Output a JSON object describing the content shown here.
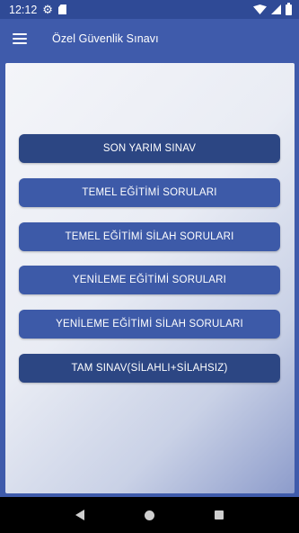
{
  "status_bar": {
    "time": "12:12",
    "icons": [
      "gear-icon",
      "sd-card-icon",
      "wifi-icon",
      "signal-icon",
      "battery-icon"
    ]
  },
  "app_bar": {
    "title": "Özel Güvenlik Sınavı",
    "menu_icon": "menu-icon"
  },
  "menu": {
    "items": [
      {
        "label": "SON YARIM SINAV",
        "style": "dark"
      },
      {
        "label": "TEMEL EĞİTİMİ SORULARI",
        "style": "mid"
      },
      {
        "label": "TEMEL EĞİTİMİ SİLAH SORULARI",
        "style": "mid"
      },
      {
        "label": "YENİLEME EĞİTİMİ SORULARI",
        "style": "mid"
      },
      {
        "label": "YENİLEME EĞİTİMİ SİLAH SORULARI",
        "style": "mid"
      },
      {
        "label": "TAM SINAV(SİLAHLI+SİLAHSIZ)",
        "style": "dark"
      }
    ]
  },
  "nav_bar": {
    "buttons": [
      "back-icon",
      "home-icon",
      "recent-apps-icon"
    ]
  },
  "colors": {
    "primary": "#3f5bab",
    "status_bar": "#2f4a96",
    "button_dark": "#2c4683",
    "button_mid": "#3d5aa8",
    "nav_bar": "#000000"
  }
}
